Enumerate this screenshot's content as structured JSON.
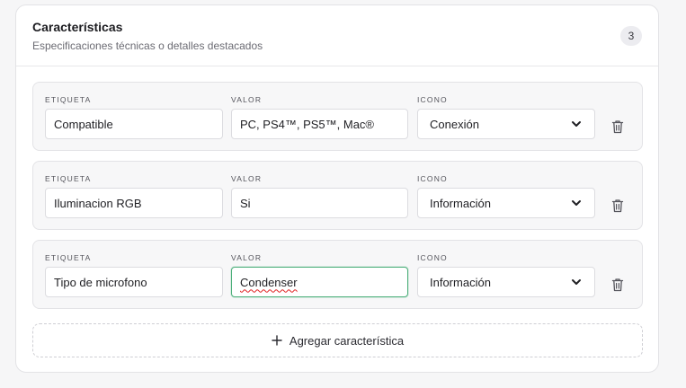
{
  "section": {
    "title": "Características",
    "subtitle": "Especificaciones técnicas o detalles destacados",
    "count": "3"
  },
  "columns": {
    "label": "ETIQUETA",
    "value": "VALOR",
    "icon": "ICONO"
  },
  "rows": [
    {
      "label": "Compatible",
      "value": "PC, PS4™, PS5™, Mac®",
      "icon": "Conexión"
    },
    {
      "label": "Iluminacion RGB",
      "value": "Si",
      "icon": "Información"
    },
    {
      "label": "Tipo de microfono",
      "value": "Condenser",
      "icon": "Información"
    }
  ],
  "add_button": {
    "label": "Agregar característica"
  },
  "icons": {
    "delete": "trash-icon",
    "add": "plus-icon",
    "dropdown": "chevron-down-icon"
  },
  "colors": {
    "focus_border": "#4caf7a",
    "spellcheck": "#e02020"
  }
}
